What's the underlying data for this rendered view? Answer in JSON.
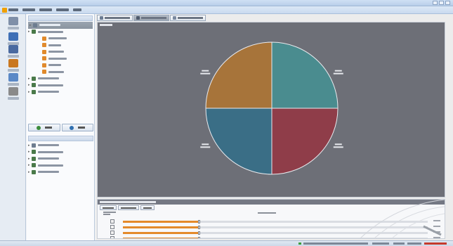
{
  "window": {
    "title": ""
  },
  "menu": {
    "items": [
      "",
      "",
      "",
      "",
      ""
    ]
  },
  "toolbar": {
    "tools": [
      {
        "icon": "open-icon",
        "label": ""
      },
      {
        "icon": "save-icon",
        "label": ""
      },
      {
        "icon": "floppy-icon",
        "label": ""
      },
      {
        "icon": "settings-icon",
        "label": ""
      },
      {
        "icon": "warning-icon",
        "label": ""
      },
      {
        "icon": "link-icon",
        "label": ""
      }
    ]
  },
  "tabs": [
    "",
    "",
    ""
  ],
  "nav_upper": {
    "header": "",
    "items": [
      {
        "label": "",
        "level": 0,
        "selected": true,
        "icon": "settings-icon"
      },
      {
        "label": "",
        "level": 0,
        "icon": "plant-icon"
      },
      {
        "label": "",
        "level": 1,
        "icon": "line-icon"
      },
      {
        "label": "",
        "level": 1,
        "icon": "line-icon"
      },
      {
        "label": "",
        "level": 1,
        "icon": "line-icon"
      },
      {
        "label": "",
        "level": 1,
        "icon": "line-icon"
      },
      {
        "label": "",
        "level": 1,
        "icon": "line-icon"
      },
      {
        "label": "",
        "level": 1,
        "icon": "line-icon"
      },
      {
        "label": "",
        "level": 0,
        "icon": "plant-icon"
      },
      {
        "label": "",
        "level": 0,
        "icon": "plant-icon"
      },
      {
        "label": "",
        "level": 0,
        "icon": "plant-icon"
      }
    ]
  },
  "buttons": {
    "left": "",
    "right": ""
  },
  "nav_lower": {
    "header": "",
    "items": [
      {
        "label": "",
        "level": 0,
        "icon": "settings-icon"
      },
      {
        "label": "",
        "level": 0,
        "icon": "plant-icon"
      },
      {
        "label": "",
        "level": 0,
        "icon": "plant-icon"
      },
      {
        "label": "",
        "level": 0,
        "icon": "plant-icon"
      },
      {
        "label": "",
        "level": 0,
        "icon": "plant-icon"
      }
    ]
  },
  "chart_panel": {
    "title": ""
  },
  "chart_data": {
    "type": "pie",
    "title": "",
    "slices": [
      {
        "value": 25,
        "color": "#4a8c8f"
      },
      {
        "value": 25,
        "color": "#8f3d49"
      },
      {
        "value": 25,
        "color": "#3a6e86"
      },
      {
        "value": 25,
        "color": "#a7743a"
      }
    ]
  },
  "bottom_panel": {
    "title": "",
    "tabs": [
      "",
      "",
      ""
    ],
    "sliders": [
      0.5,
      0.5,
      0.5,
      0.5
    ]
  },
  "status": {
    "text": ""
  }
}
